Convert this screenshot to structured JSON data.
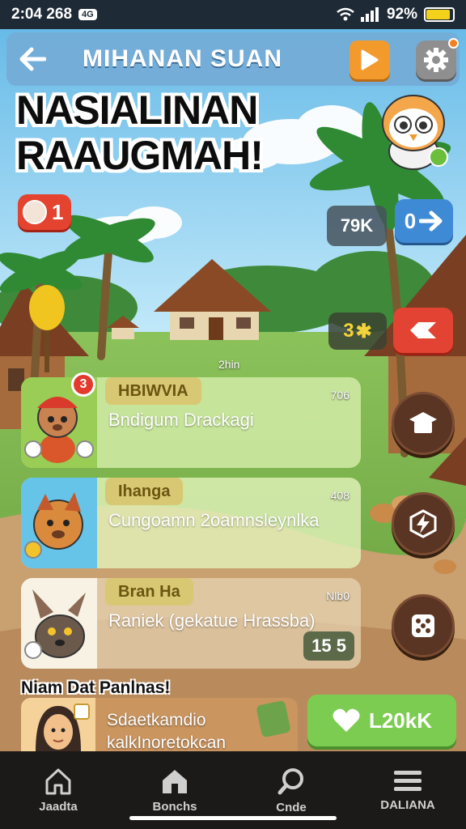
{
  "status_bar": {
    "time": "2:04 268",
    "badge": "4G",
    "battery_text": "92%",
    "battery_level": 0.85
  },
  "header": {
    "title": "MIHANAN SUAN",
    "back_icon": "arrow-left-icon",
    "play_icon": "play-icon",
    "settings_icon": "gear-icon"
  },
  "banner": {
    "line1": "NASIALINAN",
    "line2": "RAAUGMAH!"
  },
  "resources": {
    "lives": "1",
    "coins": "79K",
    "gems": "0",
    "stars": "3"
  },
  "center_label": "2hin",
  "quests": [
    {
      "tag": "HBIWVIA",
      "title": "Bndigum Drackagi",
      "time": "706",
      "badge": "3",
      "reward": ""
    },
    {
      "tag": "Ihanga",
      "title": "Cungoamn 2oamnsleynlkа",
      "time": "408",
      "badge": "",
      "reward": ""
    },
    {
      "tag": "Bran Ha",
      "title": "Raniek (gekatue Hrassba)",
      "time": "Nlb0",
      "badge": "",
      "reward": "15  5"
    }
  ],
  "friends": {
    "label": "Niam Dat Panlnas!",
    "text_line1": "Sdaetkamdio",
    "text_line2": "kalkInoretokcan",
    "like_label": "L20kK"
  },
  "bottom_nav": [
    {
      "label": "Jaadta",
      "icon": "home-icon"
    },
    {
      "label": "Bonchs",
      "icon": "house-icon"
    },
    {
      "label": "Cnde",
      "icon": "search-icon"
    },
    {
      "label": "DALIANA",
      "icon": "menu-icon"
    }
  ],
  "colors": {
    "accent_orange": "#f39a2c",
    "accent_red": "#e24332",
    "accent_green": "#7ccc52",
    "accent_blue": "#3f8ad4",
    "nav_bg": "#1c1a18"
  }
}
